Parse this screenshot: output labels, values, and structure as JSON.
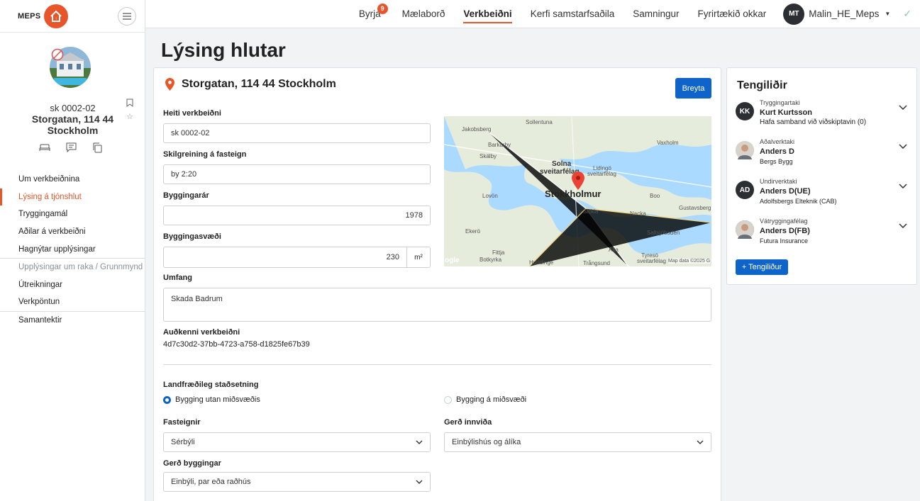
{
  "brand": "MEPS",
  "property": {
    "id": "sk 0002-02",
    "address": "Storgatan, 114 44 Stockholm"
  },
  "sidebar": {
    "items": [
      {
        "label": "Um verkbeiðnina",
        "state": "normal"
      },
      {
        "label": "Lýsing á tjónshlut",
        "state": "active"
      },
      {
        "label": "Tryggingamál",
        "state": "normal"
      },
      {
        "label": "Aðilar á verkbeiðni",
        "state": "normal"
      },
      {
        "label": "Hagnýtar upplýsingar",
        "state": "normal"
      },
      {
        "label": "Upplýsingar um raka / Grunnmynd",
        "state": "disabled"
      },
      {
        "label": "Útreikningar",
        "state": "normal"
      },
      {
        "label": "Verkpöntun",
        "state": "normal"
      },
      {
        "label": "Samantektir",
        "state": "normal"
      }
    ]
  },
  "topnav": {
    "items": [
      {
        "label": "Byrja",
        "badge": "9"
      },
      {
        "label": "Mælaborð"
      },
      {
        "label": "Verkbeiðni",
        "active": true
      },
      {
        "label": "Kerfi samstarfsaðila"
      },
      {
        "label": "Samningur"
      },
      {
        "label": "Fyrirtækið okkar"
      }
    ],
    "user": {
      "initials": "MT",
      "name": "Malin_HE_Meps"
    }
  },
  "page_title": "Lýsing hlutar",
  "main": {
    "address": "Storgatan, 114 44 Stockholm",
    "edit_label": "Breyta",
    "fields": {
      "heiti": {
        "label": "Heiti verkbeiðni",
        "value": "sk 0002-02"
      },
      "skilgreining": {
        "label": "Skilgreining á fasteign",
        "value": "by 2:20"
      },
      "byggingarar": {
        "label": "Byggingarár",
        "value": "1978"
      },
      "byggingasvaedi": {
        "label": "Byggingasvæði",
        "value": "230",
        "unit": "m²"
      },
      "umfang": {
        "label": "Umfang",
        "value": "Skada Badrum"
      },
      "audkenni": {
        "label": "Auðkenni verkbeiðni",
        "value": "4d7c30d2-37bb-4723-a758-d1825fe67b39"
      }
    },
    "geo": {
      "label": "Landfræðileg staðsetning",
      "options": [
        {
          "label": "Bygging utan miðsvæðis",
          "selected": true
        },
        {
          "label": "Bygging á miðsvæði",
          "selected": false
        }
      ]
    },
    "fasteignir": {
      "label": "Fasteignir",
      "value": "Sérbýli"
    },
    "gerd_innvida": {
      "label": "Gerð innviða",
      "value": "Einbýlishús og álíka"
    },
    "gerd_byggingar": {
      "label": "Gerð byggingar",
      "value": "Einbýli, par eða raðhús"
    },
    "map": {
      "labels": [
        "Sollentuna",
        "Jakobsberg",
        "Barkarby",
        "Skälby",
        "Solna",
        "sveitarfélag",
        "Lidingö",
        "sveitarfélag",
        "Vaxholm",
        "Stokkholmur",
        "Lovön",
        "Sickla",
        "Boo",
        "Gustavsberg",
        "Nacka",
        "Ekerö",
        "Saltsjöbaden",
        "Fittja",
        "Botkyrka",
        "Huddinge",
        "Alta",
        "Trångsund",
        "Tyresö",
        "sveitarfélag",
        "Map data ©2025 G",
        "ogle"
      ]
    }
  },
  "contacts": {
    "title": "Tengiliðir",
    "add_label": "+ Tengiliður",
    "items": [
      {
        "role": "Tryggingartaki",
        "name": "Kurt Kurtsson",
        "sub": "Hafa samband við viðskiptavin (0)",
        "initials": "KK"
      },
      {
        "role": "Aðalverktaki",
        "name": "Anders D",
        "sub": "Bergs Bygg",
        "initials": ""
      },
      {
        "role": "Undirverktaki",
        "name": "Anders D(UE)",
        "sub": "Adolfsbergs Elteknik (CAB)",
        "initials": "AD"
      },
      {
        "role": "Vátryggingafélag",
        "name": "Anders D(FB)",
        "sub": "Futura Insurance",
        "initials": ""
      }
    ]
  }
}
